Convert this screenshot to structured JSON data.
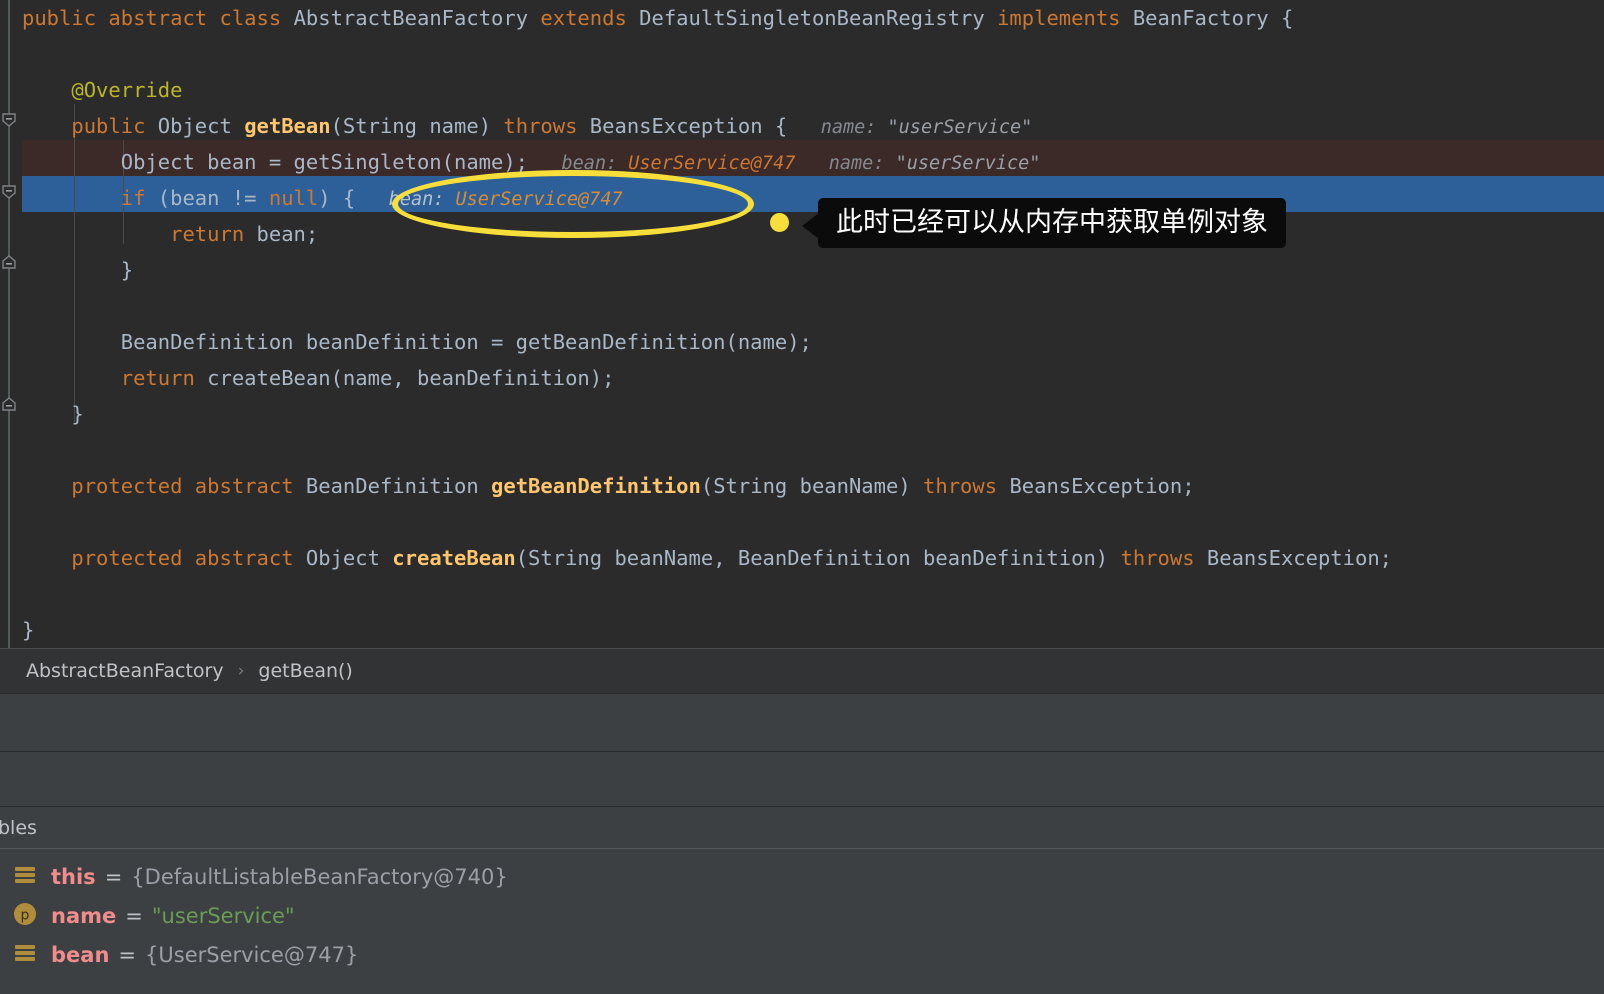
{
  "editor": {
    "language": "java",
    "lines": [
      {
        "id": "line-class-decl",
        "tokens": [
          {
            "t": "public ",
            "c": "kw"
          },
          {
            "t": "abstract ",
            "c": "kw"
          },
          {
            "t": "class ",
            "c": "kw"
          },
          {
            "t": "AbstractBeanFactory ",
            "c": "cls"
          },
          {
            "t": "extends ",
            "c": "kw"
          },
          {
            "t": "DefaultSingletonBeanRegistry ",
            "c": "cls"
          },
          {
            "t": "implements ",
            "c": "kw"
          },
          {
            "t": "BeanFactory {",
            "c": "cls"
          }
        ]
      },
      {
        "id": "line-blank-1",
        "tokens": []
      },
      {
        "id": "line-override",
        "tokens": [
          {
            "t": "    @Override",
            "c": "ann"
          }
        ]
      },
      {
        "id": "line-getbean-sig",
        "tokens": [
          {
            "t": "    ",
            "c": "pln"
          },
          {
            "t": "public ",
            "c": "kw"
          },
          {
            "t": "Object ",
            "c": "cls"
          },
          {
            "t": "getBean",
            "c": "mth"
          },
          {
            "t": "(String name) ",
            "c": "pln"
          },
          {
            "t": "throws ",
            "c": "kw"
          },
          {
            "t": "BeansException {",
            "c": "pln"
          },
          {
            "t": "   name: ",
            "c": "hint"
          },
          {
            "t": "\"userService\"",
            "c": "hintstr"
          }
        ]
      },
      {
        "id": "line-getsingleton",
        "highlight": "exec",
        "tokens": [
          {
            "t": "        Object bean = getSingleton(name);",
            "c": "pln"
          },
          {
            "t": "   bean: ",
            "c": "hint"
          },
          {
            "t": "UserService@747",
            "c": "hintval"
          },
          {
            "t": "   name: ",
            "c": "hint"
          },
          {
            "t": "\"userService\"",
            "c": "hintstr"
          }
        ]
      },
      {
        "id": "line-if-bean-null",
        "highlight": "selected",
        "tokens": [
          {
            "t": "        ",
            "c": "pln"
          },
          {
            "t": "if ",
            "c": "kw"
          },
          {
            "t": "(bean != ",
            "c": "pln"
          },
          {
            "t": "null",
            "c": "kw"
          },
          {
            "t": ") {",
            "c": "pln"
          },
          {
            "t": "   bean: ",
            "c": "hint-lt"
          },
          {
            "t": "UserService@747",
            "c": "hintval-lt"
          }
        ]
      },
      {
        "id": "line-return-bean",
        "tokens": [
          {
            "t": "            ",
            "c": "pln"
          },
          {
            "t": "return ",
            "c": "kw"
          },
          {
            "t": "bean;",
            "c": "pln"
          }
        ]
      },
      {
        "id": "line-close-if",
        "tokens": [
          {
            "t": "        }",
            "c": "pln"
          }
        ]
      },
      {
        "id": "line-blank-2",
        "tokens": []
      },
      {
        "id": "line-beandefinition",
        "tokens": [
          {
            "t": "        BeanDefinition beanDefinition = getBeanDefinition(name);",
            "c": "pln"
          }
        ]
      },
      {
        "id": "line-return-createbean",
        "tokens": [
          {
            "t": "        ",
            "c": "pln"
          },
          {
            "t": "return ",
            "c": "kw"
          },
          {
            "t": "createBean(name, beanDefinition);",
            "c": "pln"
          }
        ]
      },
      {
        "id": "line-close-method",
        "tokens": [
          {
            "t": "    }",
            "c": "pln"
          }
        ]
      },
      {
        "id": "line-blank-3",
        "tokens": []
      },
      {
        "id": "line-abstract-getbeandefinition",
        "tokens": [
          {
            "t": "    ",
            "c": "pln"
          },
          {
            "t": "protected ",
            "c": "kw"
          },
          {
            "t": "abstract ",
            "c": "kw"
          },
          {
            "t": "BeanDefinition ",
            "c": "cls"
          },
          {
            "t": "getBeanDefinition",
            "c": "mth"
          },
          {
            "t": "(String beanName) ",
            "c": "pln"
          },
          {
            "t": "throws ",
            "c": "kw"
          },
          {
            "t": "BeansException;",
            "c": "pln"
          }
        ]
      },
      {
        "id": "line-blank-4",
        "tokens": []
      },
      {
        "id": "line-abstract-createbean",
        "tokens": [
          {
            "t": "    ",
            "c": "pln"
          },
          {
            "t": "protected ",
            "c": "kw"
          },
          {
            "t": "abstract ",
            "c": "kw"
          },
          {
            "t": "Object ",
            "c": "cls"
          },
          {
            "t": "createBean",
            "c": "mth"
          },
          {
            "t": "(String beanName, BeanDefinition beanDefinition) ",
            "c": "pln"
          },
          {
            "t": "throws ",
            "c": "kw"
          },
          {
            "t": "BeansException;",
            "c": "pln"
          }
        ]
      },
      {
        "id": "line-blank-5",
        "tokens": []
      },
      {
        "id": "line-close-class",
        "tokens": [
          {
            "t": "}",
            "c": "pln"
          }
        ]
      }
    ]
  },
  "annotation": {
    "callout_text": "此时已经可以从内存中获取单例对象",
    "ellipse_color": "#f7de3a",
    "dot_color": "#f7de3a",
    "callout_bg": "#0b0b0b",
    "callout_fg": "#ffffff"
  },
  "breadcrumb": {
    "items": [
      "AbstractBeanFactory",
      "getBean()"
    ],
    "separator": "›"
  },
  "variables_panel": {
    "title": "bles",
    "rows": [
      {
        "icon": "object-icon",
        "name": "this",
        "eq": "=",
        "value": "{DefaultListableBeanFactory@740}",
        "value_kind": "ref"
      },
      {
        "icon": "parameter-icon",
        "name": "name",
        "eq": "=",
        "value": "\"userService\"",
        "value_kind": "string"
      },
      {
        "icon": "object-icon",
        "name": "bean",
        "eq": "=",
        "value": "{UserService@747}",
        "value_kind": "ref"
      }
    ]
  },
  "colors": {
    "editor_bg": "#2b2b2b",
    "exec_line_bg": "#3b2a28",
    "selected_line_bg": "#2d6099",
    "panel_bg": "#3c4043",
    "breadcrumb_bg": "#313335",
    "keyword": "#cc7832",
    "method": "#ffc66d",
    "annotation": "#bbb529",
    "string": "#6a8759",
    "text": "#a9b7c6"
  }
}
